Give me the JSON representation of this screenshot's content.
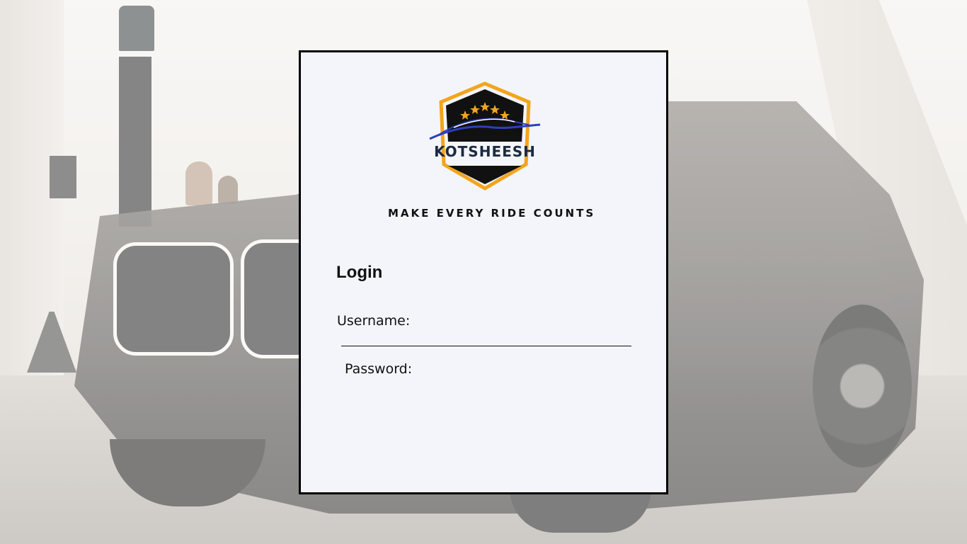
{
  "brand": {
    "name": "KOTSHEESH",
    "tagline": "MAKE EVERY RIDE COUNTS",
    "logo_icon": "shield-car-logo",
    "colors": {
      "shield_outline": "#f2a51c",
      "shield_fill": "#111111",
      "car_swoosh": "#2c3fbf",
      "star": "#f2a51c",
      "text": "#1b2a3f"
    }
  },
  "login": {
    "title": "Login",
    "username_label": "Username:",
    "username_value": "",
    "password_label": "Password:",
    "password_value": ""
  },
  "colors": {
    "card_background": "#f4f5fa",
    "card_border": "#000000"
  }
}
